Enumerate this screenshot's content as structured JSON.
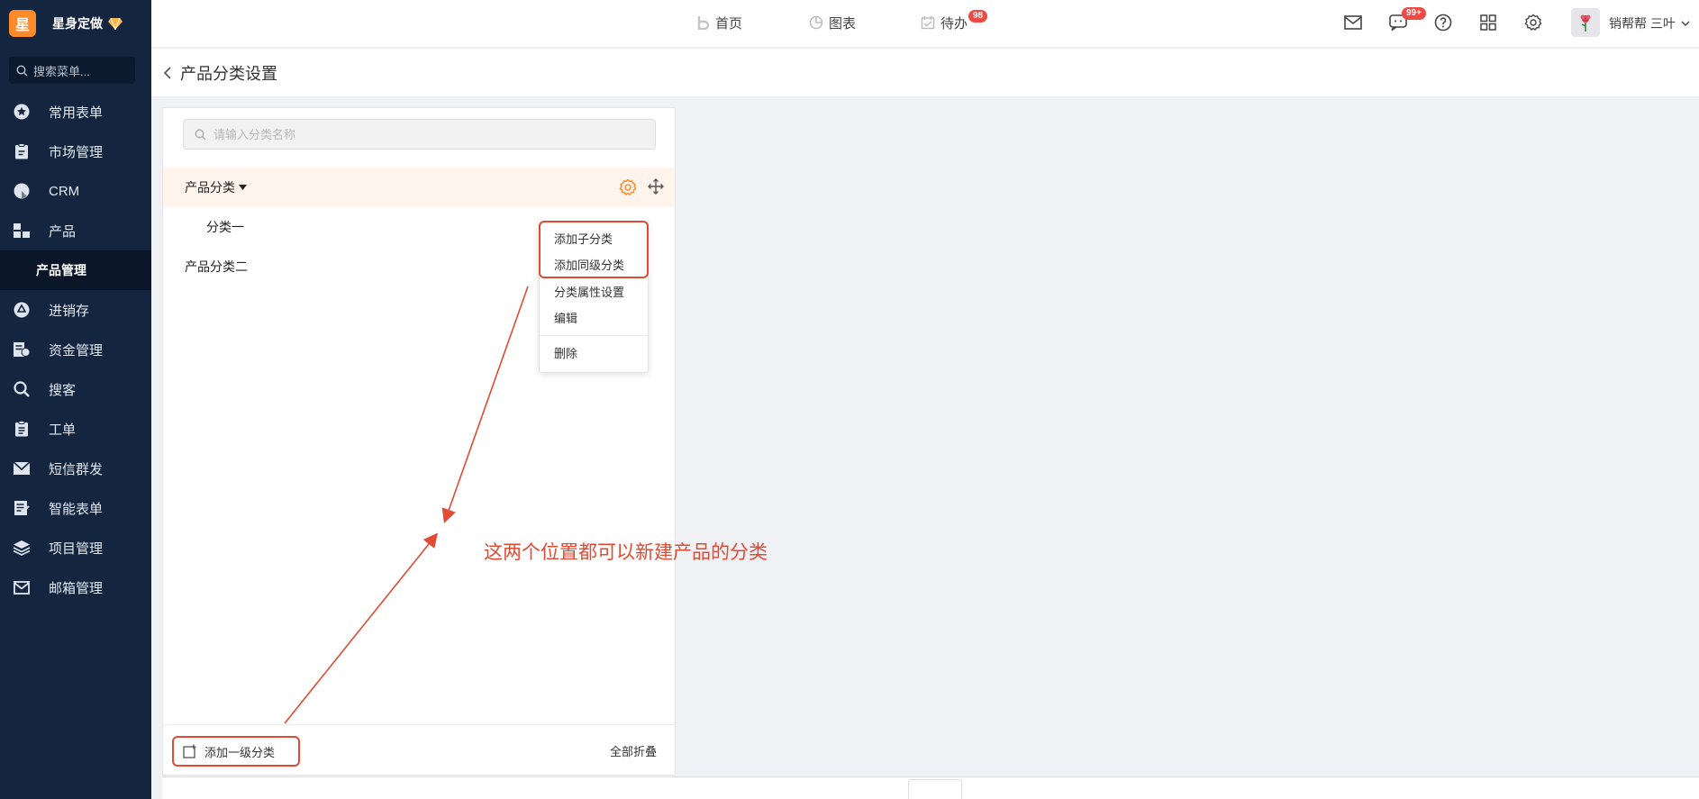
{
  "brand": {
    "logo_char": "星",
    "name": "星身定做"
  },
  "menu_search": {
    "placeholder": "搜索菜单..."
  },
  "sidebar": {
    "items": [
      {
        "label": "常用表单",
        "icon": "star-icon"
      },
      {
        "label": "市场管理",
        "icon": "clipboard-icon"
      },
      {
        "label": "CRM",
        "icon": "pie-icon"
      },
      {
        "label": "产品",
        "icon": "boxes-icon"
      },
      {
        "label": "进销存",
        "icon": "cycle-icon"
      },
      {
        "label": "资金管理",
        "icon": "finance-icon"
      },
      {
        "label": "搜客",
        "icon": "search-icon"
      },
      {
        "label": "工单",
        "icon": "ticket-icon"
      },
      {
        "label": "短信群发",
        "icon": "envelope-icon"
      },
      {
        "label": "智能表单",
        "icon": "form-icon"
      },
      {
        "label": "项目管理",
        "icon": "layers-icon"
      },
      {
        "label": "邮箱管理",
        "icon": "mail-icon"
      }
    ],
    "active_sub": "产品管理"
  },
  "topnav": {
    "home": "首页",
    "charts": "图表",
    "todo": "待办",
    "todo_badge": "98",
    "chat_badge": "99+"
  },
  "user": {
    "name": "销帮帮 三叶"
  },
  "page": {
    "title": "产品分类设置"
  },
  "category": {
    "search_placeholder": "请输入分类名称",
    "tree": [
      {
        "label": "产品分类",
        "level": 0,
        "expanded": true
      },
      {
        "label": "分类一",
        "level": 1
      },
      {
        "label": "产品分类二",
        "level": 0
      }
    ],
    "add_top_label": "添加一级分类",
    "collapse_all_label": "全部折叠"
  },
  "context_menu": {
    "add_child": "添加子分类",
    "add_sibling": "添加同级分类",
    "attr_settings": "分类属性设置",
    "edit": "编辑",
    "delete": "删除"
  },
  "annotation": {
    "text": "这两个位置都可以新建产品的分类"
  },
  "colors": {
    "accent": "#ff8a2a",
    "sidebar_bg": "#14253f",
    "annotation_red": "#e14a33",
    "badge_red": "#f04a45"
  }
}
